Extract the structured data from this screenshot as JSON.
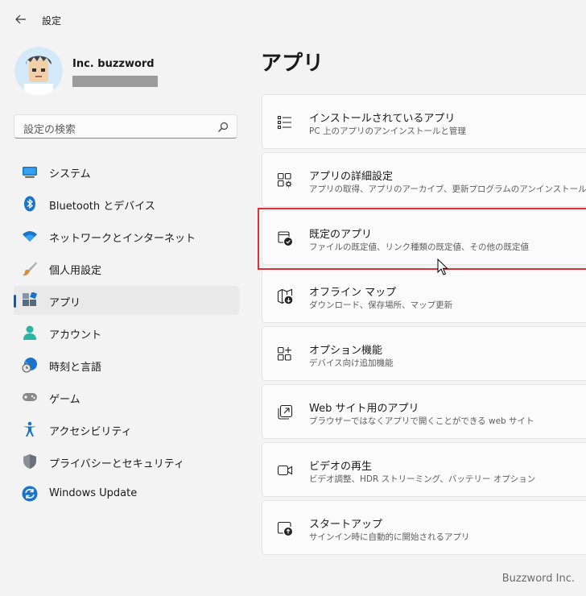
{
  "window": {
    "title": "設定"
  },
  "profile": {
    "name": "Inc. buzzword"
  },
  "search": {
    "placeholder": "設定の検索"
  },
  "nav": [
    {
      "label": "システム",
      "icon": "system-icon"
    },
    {
      "label": "Bluetooth とデバイス",
      "icon": "bluetooth-icon"
    },
    {
      "label": "ネットワークとインターネット",
      "icon": "wifi-icon"
    },
    {
      "label": "個人用設定",
      "icon": "brush-icon"
    },
    {
      "label": "アプリ",
      "icon": "apps-icon",
      "active": true
    },
    {
      "label": "アカウント",
      "icon": "account-icon"
    },
    {
      "label": "時刻と言語",
      "icon": "globe-clock-icon"
    },
    {
      "label": "ゲーム",
      "icon": "gamepad-icon"
    },
    {
      "label": "アクセシビリティ",
      "icon": "accessibility-icon"
    },
    {
      "label": "プライバシーとセキュリティ",
      "icon": "shield-icon"
    },
    {
      "label": "Windows Update",
      "icon": "update-icon"
    }
  ],
  "page": {
    "title": "アプリ"
  },
  "cards": [
    {
      "title": "インストールされているアプリ",
      "subtitle": "PC 上のアプリのアンインストールと管理",
      "icon": "list-icon"
    },
    {
      "title": "アプリの詳細設定",
      "subtitle": "アプリの取得、アプリのアーカイブ、更新プログラムのアンインストールを行う",
      "icon": "app-settings-icon"
    },
    {
      "title": "既定のアプリ",
      "subtitle": "ファイルの既定値、リンク種類の既定値、その他の既定値",
      "icon": "default-apps-icon"
    },
    {
      "title": "オフライン マップ",
      "subtitle": "ダウンロード、保存場所、マップ更新",
      "icon": "map-download-icon"
    },
    {
      "title": "オプション機能",
      "subtitle": "デバイス向け追加機能",
      "icon": "add-grid-icon"
    },
    {
      "title": "Web サイト用のアプリ",
      "subtitle": "ブラウザーではなくアプリで開くことができる web サイト",
      "icon": "open-external-icon"
    },
    {
      "title": "ビデオの再生",
      "subtitle": "ビデオ調整、HDR ストリーミング、バッテリー オプション",
      "icon": "video-icon"
    },
    {
      "title": "スタートアップ",
      "subtitle": "サインイン時に自動的に開始されるアプリ",
      "icon": "startup-icon"
    }
  ],
  "watermark": "Buzzword Inc.",
  "colors": {
    "accent": "#005fb8",
    "highlight": "#d9323a",
    "background": "#f3f3f3",
    "card": "#fbfbfb"
  }
}
